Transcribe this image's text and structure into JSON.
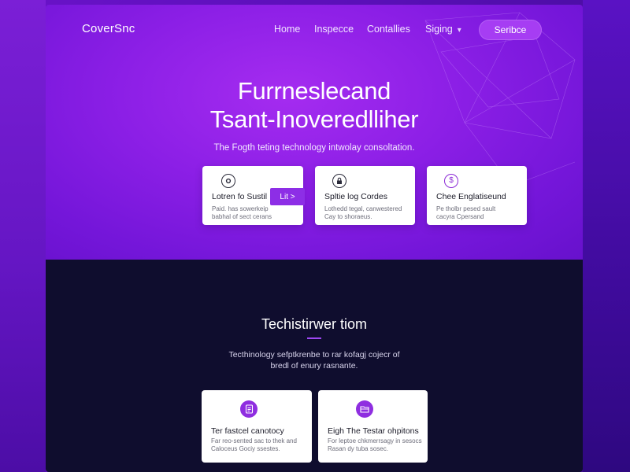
{
  "header": {
    "logo": "CoverSnc",
    "nav": [
      "Home",
      "Inspecce",
      "Contallies",
      "Siging"
    ],
    "cta": "Seribce"
  },
  "hero": {
    "title_line1": "Furrneslecand",
    "title_line2": "Tsant-Inoveredlliher",
    "subtitle": "The Fogth teting technology intwolay consoltation."
  },
  "cards": [
    {
      "icon": "gear-icon",
      "title": "Lotren fo Sustil",
      "text1": "Paid. has sowerkeip",
      "text2": "babhal of sect cerans",
      "badge": "Lit >"
    },
    {
      "icon": "lock-icon",
      "title": "Spltie log Cordes",
      "text1": "Lothedd tegal, canwestered",
      "text2": "Cay to shoraeus.",
      "badge": ""
    },
    {
      "icon": "dollar-icon",
      "title": "Chee Englatiseund",
      "text1": "Pe tholbr pesed sault",
      "text2": "cacyra Cpersand",
      "badge": ""
    }
  ],
  "section": {
    "title": "Techistirwer tiom",
    "text_line1": "Tecthinology sefptkrenbe to rar kofagj cojecr of",
    "text_line2": "bredl of enury rasnante."
  },
  "features": [
    {
      "icon": "document-icon",
      "title": "Ter fastcel canotocy",
      "text1": "Far reo-sented sac to thek and",
      "text2": "Caloceus Gociy ssestes."
    },
    {
      "icon": "folder-icon",
      "title": "Eigh The Testar ohpitons",
      "text1": "For leptoe chkmerrsagy in sesocs",
      "text2": "Rasan dy tuba sosec."
    }
  ],
  "colors": {
    "accent": "#8d2ee6",
    "hero_bg": "#8c1fe6",
    "dark_bg": "#0f0d2e"
  }
}
